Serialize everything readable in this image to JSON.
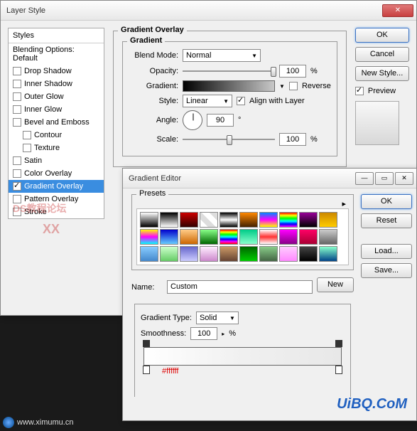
{
  "layerStyle": {
    "title": "Layer Style",
    "stylesHeader": "Styles",
    "blendingOptions": "Blending Options: Default",
    "items": [
      {
        "label": "Drop Shadow",
        "checked": false,
        "sub": false
      },
      {
        "label": "Inner Shadow",
        "checked": false,
        "sub": false
      },
      {
        "label": "Outer Glow",
        "checked": false,
        "sub": false
      },
      {
        "label": "Inner Glow",
        "checked": false,
        "sub": false
      },
      {
        "label": "Bevel and Emboss",
        "checked": false,
        "sub": false
      },
      {
        "label": "Contour",
        "checked": false,
        "sub": true
      },
      {
        "label": "Texture",
        "checked": false,
        "sub": true
      },
      {
        "label": "Satin",
        "checked": false,
        "sub": false
      },
      {
        "label": "Color Overlay",
        "checked": false,
        "sub": false
      },
      {
        "label": "Gradient Overlay",
        "checked": true,
        "sub": false,
        "selected": true
      },
      {
        "label": "Pattern Overlay",
        "checked": false,
        "sub": false
      },
      {
        "label": "Stroke",
        "checked": false,
        "sub": false
      }
    ],
    "section": {
      "title": "Gradient Overlay",
      "subTitle": "Gradient",
      "blendModeLabel": "Blend Mode:",
      "blendMode": "Normal",
      "opacityLabel": "Opacity:",
      "opacity": "100",
      "pct": "%",
      "gradientLabel": "Gradient:",
      "reverseLabel": "Reverse",
      "styleLabel": "Style:",
      "style": "Linear",
      "alignLabel": "Align with Layer",
      "angleLabel": "Angle:",
      "angle": "90",
      "deg": "°",
      "scaleLabel": "Scale:",
      "scale": "100"
    },
    "buttons": {
      "ok": "OK",
      "cancel": "Cancel",
      "newStyle": "New Style...",
      "previewLabel": "Preview"
    }
  },
  "gradientEditor": {
    "title": "Gradient Editor",
    "presetsLabel": "Presets",
    "presets": [
      "linear-gradient(#fff,#000)",
      "linear-gradient(#000,#fff)",
      "linear-gradient(#c00,#300)",
      "linear-gradient(45deg,#fff 25%,#ddd 25%,#ddd 50%,#fff 50%,#fff 75%,#ddd 75%)",
      "linear-gradient(#000,#fff,#000)",
      "linear-gradient(#f80,#420)",
      "linear-gradient(#08f,#f0f,#ff0)",
      "linear-gradient(#f00,#ff0,#0f0,#0ff,#00f,#f0f)",
      "linear-gradient(#909,#000)",
      "linear-gradient(#c80,#fc0)",
      "linear-gradient(#ff0,#f0f,#0ff)",
      "linear-gradient(#00c,#6cf)",
      "linear-gradient(#fc8,#c60)",
      "linear-gradient(#8f8,#060)",
      "linear-gradient(#f00,#ff0,#0f0,#0ff,#00f,#f0f,#f00)",
      "linear-gradient(#0c8,#8fc)",
      "linear-gradient(#fff,#f33,#fff)",
      "linear-gradient(#f0f,#808)",
      "linear-gradient(#f06,#a03)",
      "linear-gradient(#ccc,#666)",
      "linear-gradient(#8cf,#48c)",
      "linear-gradient(#cfc,#6c6)",
      "linear-gradient(#66c,#ccf)",
      "linear-gradient(#fef,#c8c)",
      "linear-gradient(#c96,#643)",
      "linear-gradient(#060,#0c0)",
      "linear-gradient(#8c8,#464)",
      "linear-gradient(#fcf,#f8f)",
      "linear-gradient(#444,#000)",
      "linear-gradient(#8fc,#048)"
    ],
    "nameLabel": "Name:",
    "name": "Custom",
    "newBtn": "New",
    "gradTypeLabel": "Gradient Type:",
    "gradType": "Solid",
    "smoothnessLabel": "Smoothness:",
    "smoothness": "100",
    "pct": "%",
    "hex": "#ffffff",
    "buttons": {
      "ok": "OK",
      "reset": "Reset",
      "load": "Load...",
      "save": "Save..."
    }
  },
  "footer": {
    "url": "www.ximumu.cn",
    "brand": "UiBQ.CoM"
  }
}
